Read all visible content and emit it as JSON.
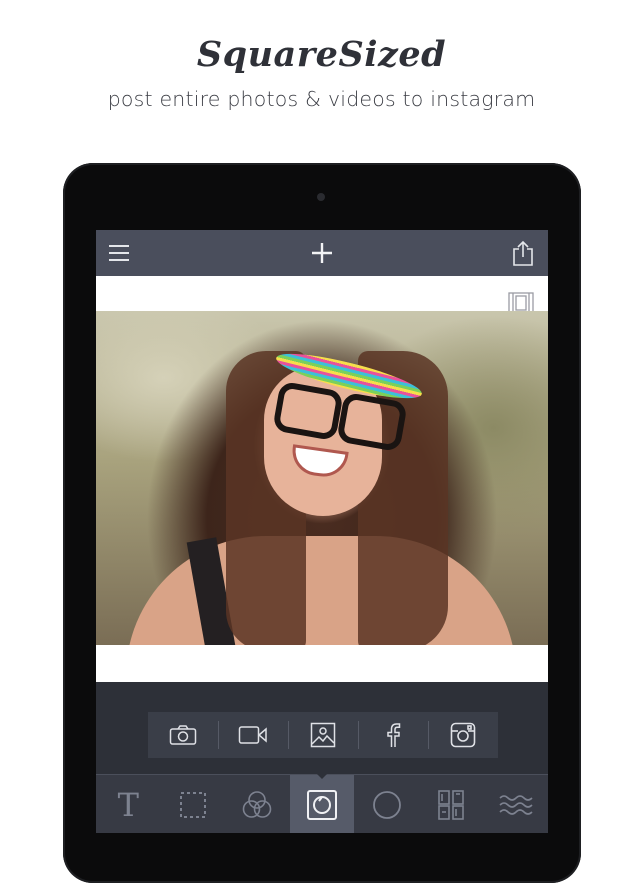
{
  "promo": {
    "app_title": "SquareSized",
    "tagline": "post entire photos & videos to instagram"
  },
  "app": {
    "topbar": {
      "menu_icon": "hamburger-menu-icon",
      "add_icon": "plus-icon",
      "share_icon": "share-export-icon"
    },
    "canvas": {
      "layout_toggle_icon": "fit-layout-icon",
      "photo_subject": "smiling girl with glasses and colorful headband"
    },
    "share_bar": [
      {
        "name": "camera",
        "icon": "camera-icon"
      },
      {
        "name": "video",
        "icon": "video-camera-icon"
      },
      {
        "name": "photo-library",
        "icon": "photo-library-icon"
      },
      {
        "name": "facebook",
        "icon": "facebook-icon"
      },
      {
        "name": "instagram",
        "icon": "instagram-icon"
      }
    ],
    "toolbar": {
      "text_tool_label": "T",
      "tools": [
        {
          "name": "text",
          "icon": "text-tool-icon"
        },
        {
          "name": "crop",
          "icon": "crop-frame-icon"
        },
        {
          "name": "color",
          "icon": "color-filter-icon"
        },
        {
          "name": "border",
          "icon": "border-frame-icon",
          "active": true
        },
        {
          "name": "shape",
          "icon": "circle-shape-icon"
        },
        {
          "name": "collage",
          "icon": "collage-text-icon"
        },
        {
          "name": "pattern",
          "icon": "waves-pattern-icon"
        }
      ]
    },
    "colors": {
      "topbar": "#4a4e5c",
      "toolbar": "#373a44",
      "active_tool": "#565b69",
      "icon": "#d9dbe0"
    }
  }
}
